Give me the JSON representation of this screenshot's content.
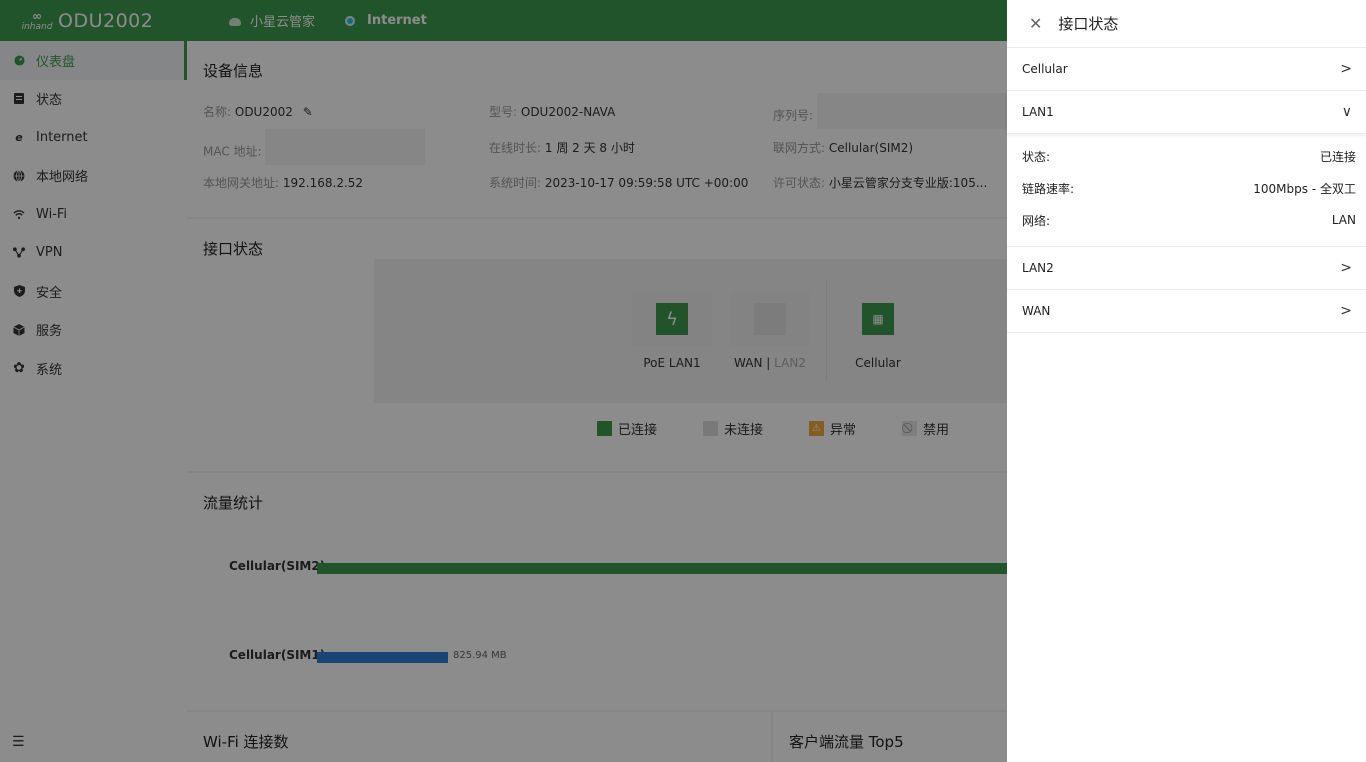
{
  "brand": {
    "logo_mark": "∞",
    "logo_word": "inhand",
    "model": "ODU2002"
  },
  "topbar": {
    "cloud_label": "小星云管家",
    "internet_label": "Internet"
  },
  "sidebar": {
    "items": [
      {
        "label": "仪表盘",
        "icon": "dashboard-icon"
      },
      {
        "label": "状态",
        "icon": "status-icon"
      },
      {
        "label": "Internet",
        "icon": "internet-icon"
      },
      {
        "label": "本地网络",
        "icon": "globe-icon"
      },
      {
        "label": "Wi-Fi",
        "icon": "wifi-icon"
      },
      {
        "label": "VPN",
        "icon": "vpn-icon"
      },
      {
        "label": "安全",
        "icon": "shield-icon"
      },
      {
        "label": "服务",
        "icon": "service-icon"
      },
      {
        "label": "系统",
        "icon": "gear-icon"
      }
    ]
  },
  "device_info": {
    "title": "设备信息",
    "name_k": "名称:",
    "name_v": "ODU2002",
    "model_k": "型号:",
    "model_v": "ODU2002-NAVA",
    "serial_k": "序列号:",
    "mac_k": "MAC 地址:",
    "uptime_k": "在线时长:",
    "uptime_v": "1 周 2 天 8 小时",
    "conn_k": "联网方式:",
    "conn_v": "Cellular(SIM2)",
    "gw_k": "本地网关地址:",
    "gw_v": "192.168.2.52",
    "time_k": "系统时间:",
    "time_v": "2023-10-17 09:59:58 UTC +00:00",
    "license_k": "许可状态:",
    "license_v": "小星云管家分支专业版:105..."
  },
  "interfaces": {
    "title": "接口状态",
    "poe_label": "PoE LAN1",
    "wan_label": "WAN",
    "sep": "|",
    "lan2_label": "LAN2",
    "cellular_label": "Cellular",
    "legend": {
      "connected": "已连接",
      "disconnected": "未连接",
      "abnormal": "异常",
      "disabled": "禁用"
    }
  },
  "traffic": {
    "title": "流量统计",
    "sim2_label": "Cellular(SIM2)",
    "sim1_label": "Cellular(SIM1)",
    "sim1_value": "825.94 MB",
    "colors": {
      "sim2": "#3f9a4f",
      "sim1": "#2d7fd3"
    }
  },
  "wifi_card": {
    "title": "Wi-Fi 连接数"
  },
  "top5_card": {
    "title": "客户端流量 Top5"
  },
  "drawer": {
    "title": "接口状态",
    "cellular": "Cellular",
    "lan1": "LAN1",
    "lan1_details": {
      "status_k": "状态:",
      "status_v": "已连接",
      "speed_k": "链路速率:",
      "speed_v": "100Mbps - 全双工",
      "network_k": "网络:",
      "network_v": "LAN"
    },
    "lan2": "LAN2",
    "wan": "WAN"
  }
}
